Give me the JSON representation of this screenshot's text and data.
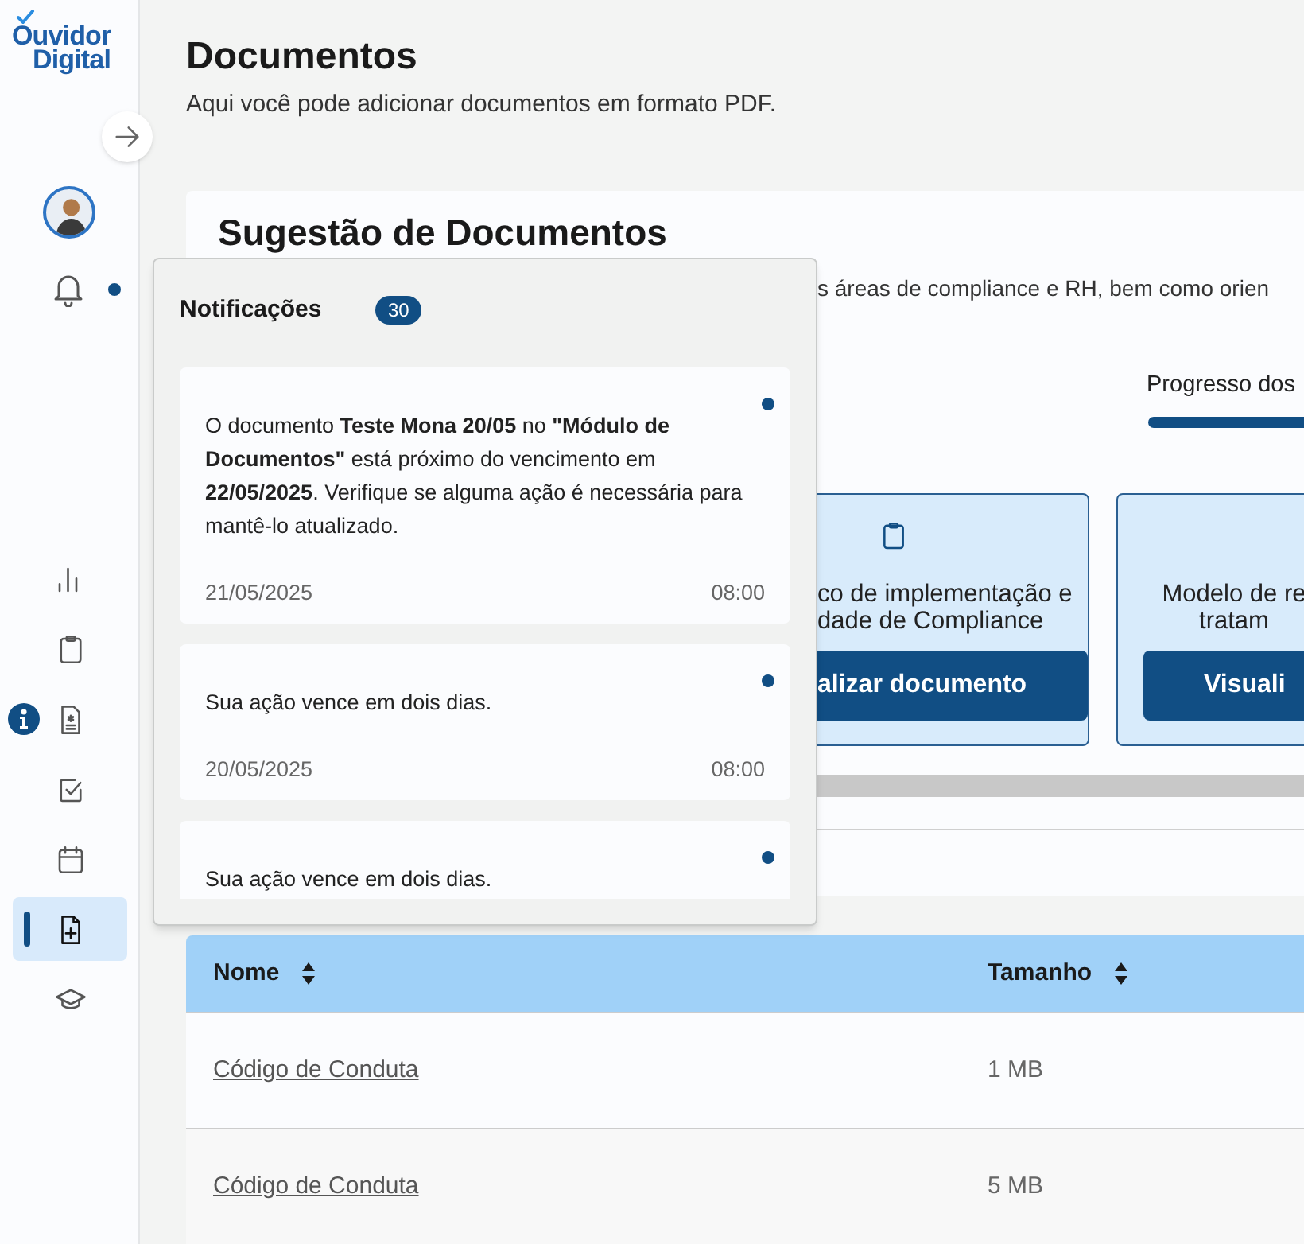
{
  "sidebar": {
    "logo": "Ouvidor Digital",
    "has_unread": true,
    "nav": [
      {
        "kind": "chart",
        "selected": false,
        "info": false
      },
      {
        "kind": "clipboard",
        "selected": false,
        "info": false
      },
      {
        "kind": "document",
        "selected": false,
        "info": true
      },
      {
        "kind": "checkbox",
        "selected": false,
        "info": false
      },
      {
        "kind": "calendar",
        "selected": false,
        "info": false
      },
      {
        "kind": "file-plus",
        "selected": true,
        "info": false
      },
      {
        "kind": "graduation",
        "selected": false,
        "info": false
      }
    ]
  },
  "page": {
    "title": "Documentos",
    "subtitle": "Aqui você pode adicionar documentos em formato PDF."
  },
  "suggestions": {
    "title": "Sugestão de Documentos",
    "description": "s áreas de compliance e RH, bem como orien",
    "progress_label": "Progresso dos",
    "cards": [
      {
        "kind": "clipboard",
        "lines": [
          "co de implementação e",
          "dade de Compliance"
        ],
        "button": "alizar documento"
      },
      {
        "kind": "plain",
        "lines": [
          "Modelo de re",
          "tratam"
        ],
        "button": "Visuali"
      }
    ]
  },
  "notifications": {
    "title": "Notificações",
    "count": "30",
    "items": [
      {
        "text": "O documento **Teste Mona 20/05** no **\"Módulo de Documentos\"** está próximo do vencimento em **22/05/2025**. Verifique se alguma ação é necessária para mantê-lo atualizado.",
        "unread": true,
        "date": "21/05/2025",
        "time": "08:00"
      },
      {
        "text": "Sua ação vence em dois dias.",
        "unread": true,
        "date": "20/05/2025",
        "time": "08:00"
      },
      {
        "text": "Sua ação vence em dois dias.",
        "unread": true
      }
    ]
  },
  "table": {
    "columns": [
      {
        "label": "Nome",
        "sortable": true
      },
      {
        "label": "Tamanho",
        "sortable": true
      }
    ],
    "rows": [
      [
        "Código de Conduta",
        "1 MB"
      ],
      [
        "Código de Conduta",
        "5 MB"
      ]
    ]
  }
}
